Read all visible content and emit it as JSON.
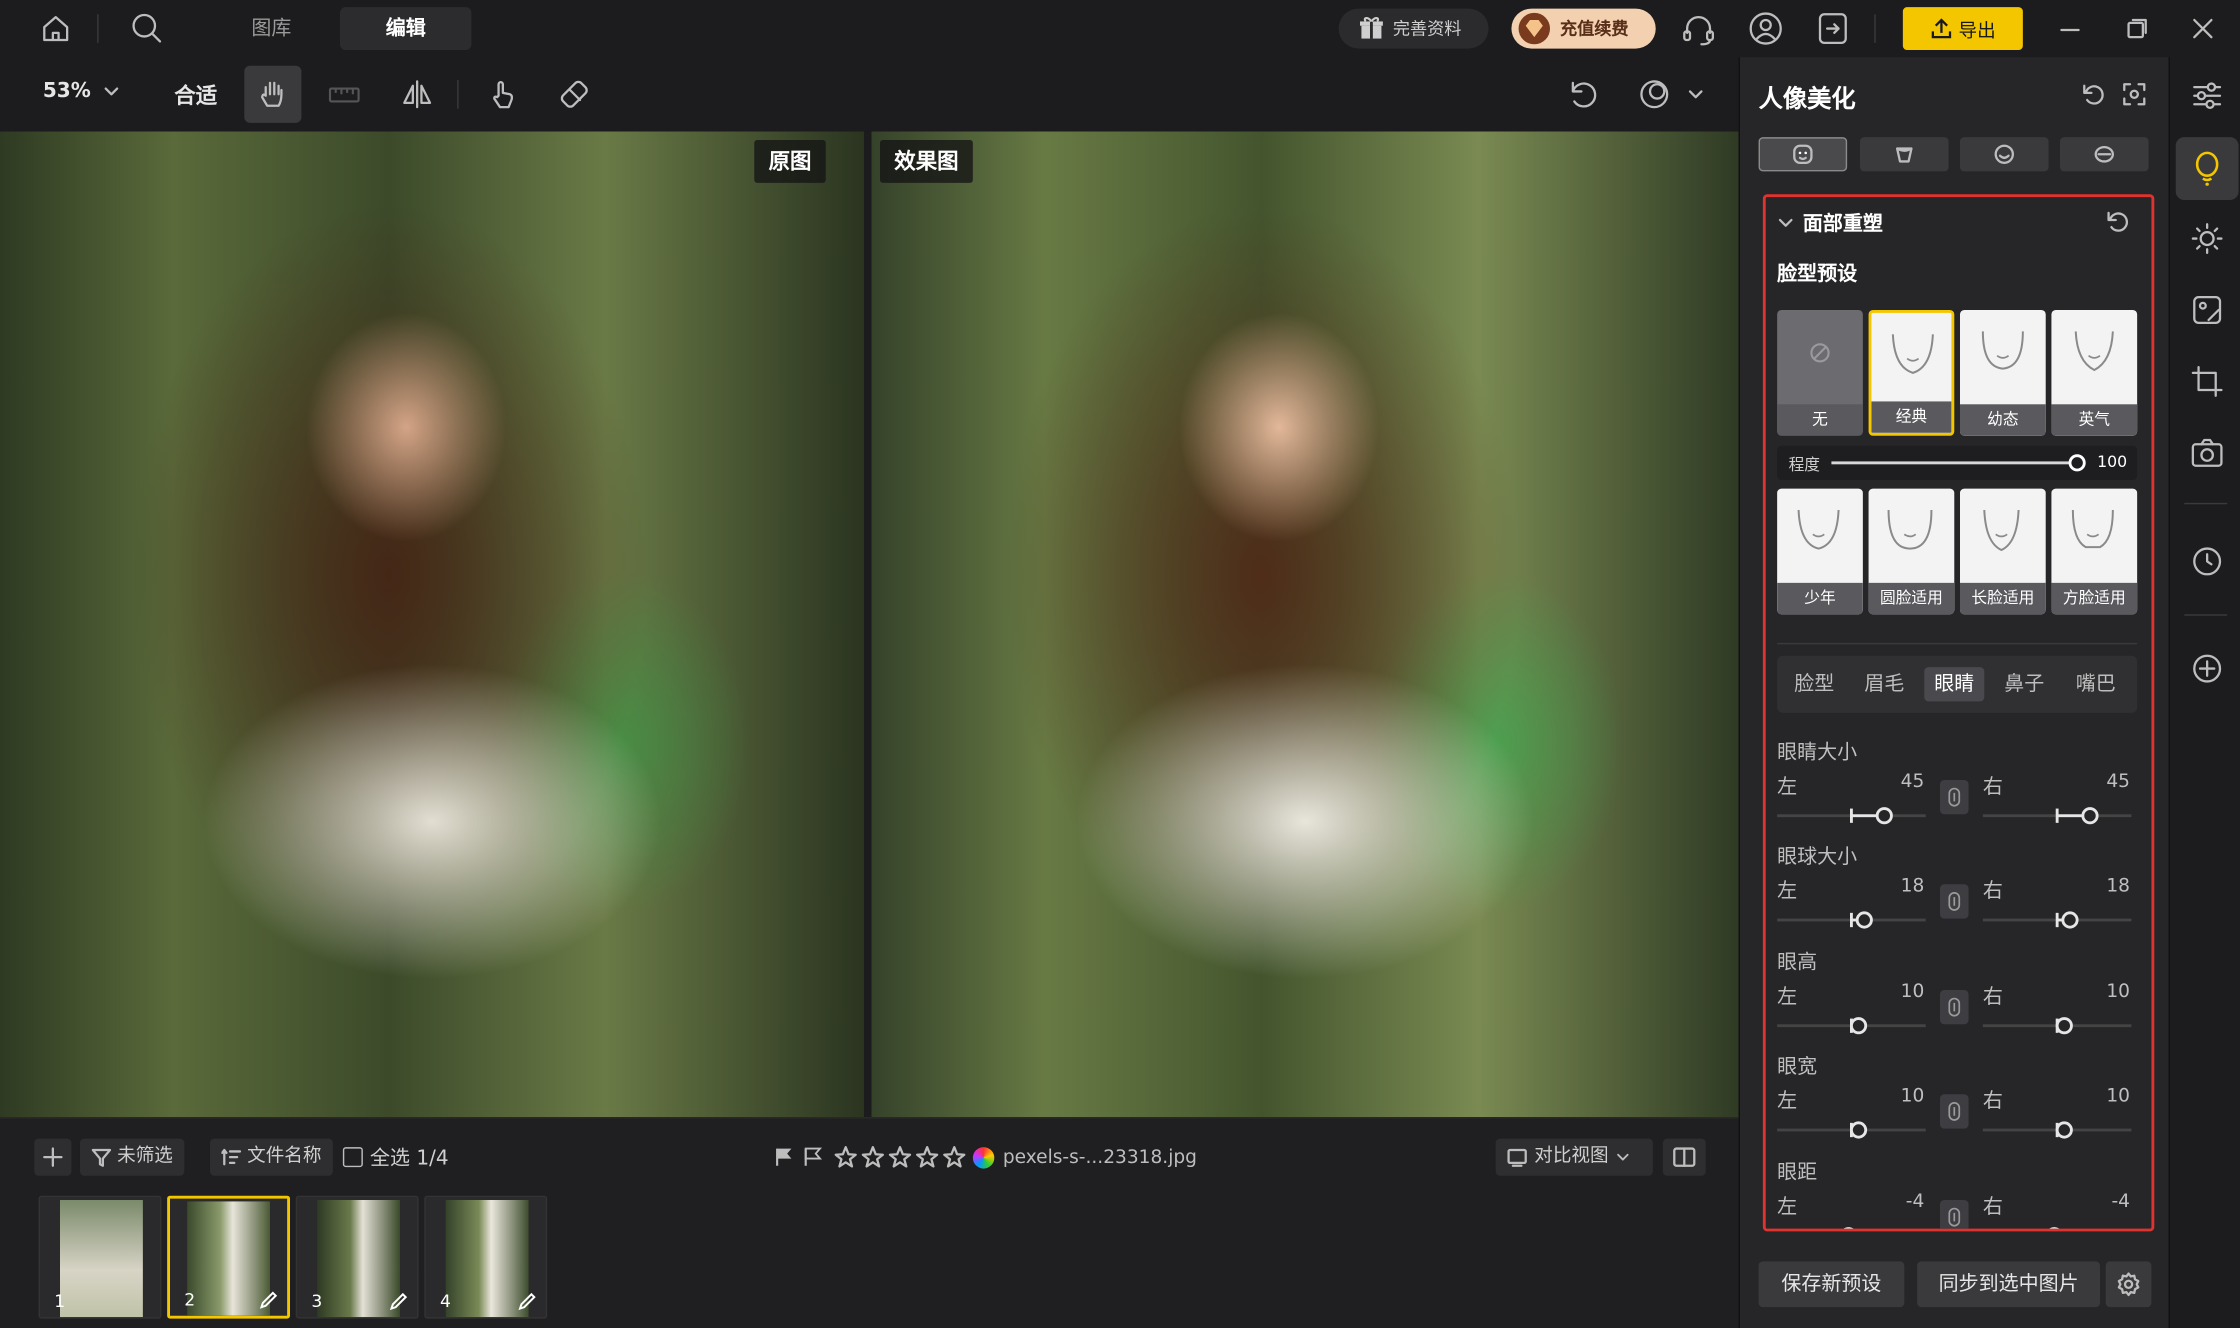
{
  "topbar": {
    "tabs": [
      {
        "label": "图库"
      },
      {
        "label": "编辑"
      }
    ],
    "complete_profile": "完善资料",
    "recharge": "充值续费",
    "export": "导出"
  },
  "toolbar": {
    "zoom": "53%",
    "fit": "合适"
  },
  "canvas": {
    "original_label": "原图",
    "result_label": "效果图"
  },
  "bottom": {
    "filter": "未筛选",
    "sort": "文件名称",
    "select_all": "全选 1/4",
    "filename": "pexels-s-...23318.jpg",
    "compare_view": "对比视图",
    "thumbnails": [
      {
        "num": "1"
      },
      {
        "num": "2"
      },
      {
        "num": "3"
      },
      {
        "num": "4"
      }
    ]
  },
  "panel": {
    "title": "人像美化",
    "section_title": "面部重塑",
    "preset_heading": "脸型预设",
    "presets_row1": [
      {
        "label": "无"
      },
      {
        "label": "经典"
      },
      {
        "label": "幼态"
      },
      {
        "label": "英气"
      }
    ],
    "degree_label": "程度",
    "degree_value": "100",
    "degree_percent": 100,
    "presets_row2": [
      {
        "label": "少年"
      },
      {
        "label": "圆脸适用"
      },
      {
        "label": "长脸适用"
      },
      {
        "label": "方脸适用"
      }
    ],
    "feature_tabs": [
      {
        "label": "脸型"
      },
      {
        "label": "眉毛"
      },
      {
        "label": "眼睛"
      },
      {
        "label": "鼻子"
      },
      {
        "label": "嘴巴"
      }
    ],
    "left_label": "左",
    "right_label": "右",
    "sliders": [
      {
        "title": "眼睛大小",
        "left": "45",
        "right": "45",
        "left_value": 45,
        "right_value": 45
      },
      {
        "title": "眼球大小",
        "left": "18",
        "right": "18",
        "left_value": 18,
        "right_value": 18
      },
      {
        "title": "眼高",
        "left": "10",
        "right": "10",
        "left_value": 10,
        "right_value": 10
      },
      {
        "title": "眼宽",
        "left": "10",
        "right": "10",
        "left_value": 10,
        "right_value": 10
      },
      {
        "title": "眼距",
        "left": "-4",
        "right": "-4",
        "left_value": -4,
        "right_value": -4
      }
    ],
    "save_preset": "保存新预设",
    "sync": "同步到选中图片"
  }
}
